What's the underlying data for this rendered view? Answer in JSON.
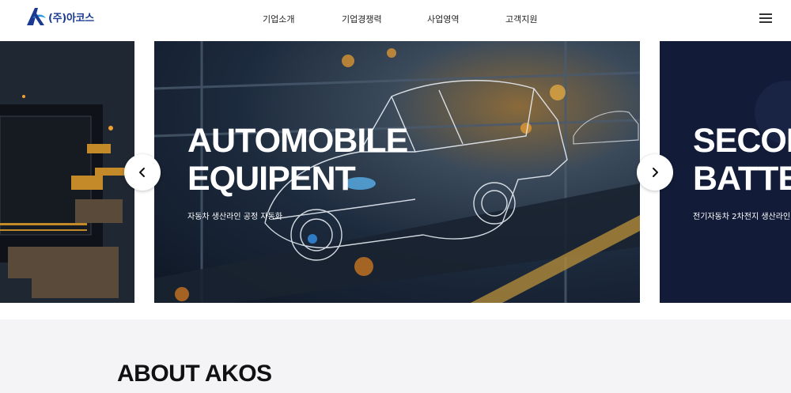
{
  "header": {
    "logo_text": "(주)아코스",
    "nav": [
      "기업소개",
      "기업경쟁력",
      "사업영역",
      "고객지원"
    ],
    "menu_icon": "hamburger-menu-icon"
  },
  "slider": {
    "slides": [
      {
        "title_line1": "AUTOMOBILE",
        "title_line2": "EQUIPENT",
        "subtitle": "자동차 생산라인 공정 자동화"
      },
      {
        "title_line1": "SECON",
        "title_line2": "BATTE",
        "subtitle": "전기자동차 2차전지 생산라인"
      }
    ],
    "prev_icon": "chevron-left-icon",
    "next_icon": "chevron-right-icon"
  },
  "about": {
    "title": "ABOUT AKOS"
  },
  "colors": {
    "brand": "#1a3a8f",
    "about_bg": "#f4f4f6"
  }
}
